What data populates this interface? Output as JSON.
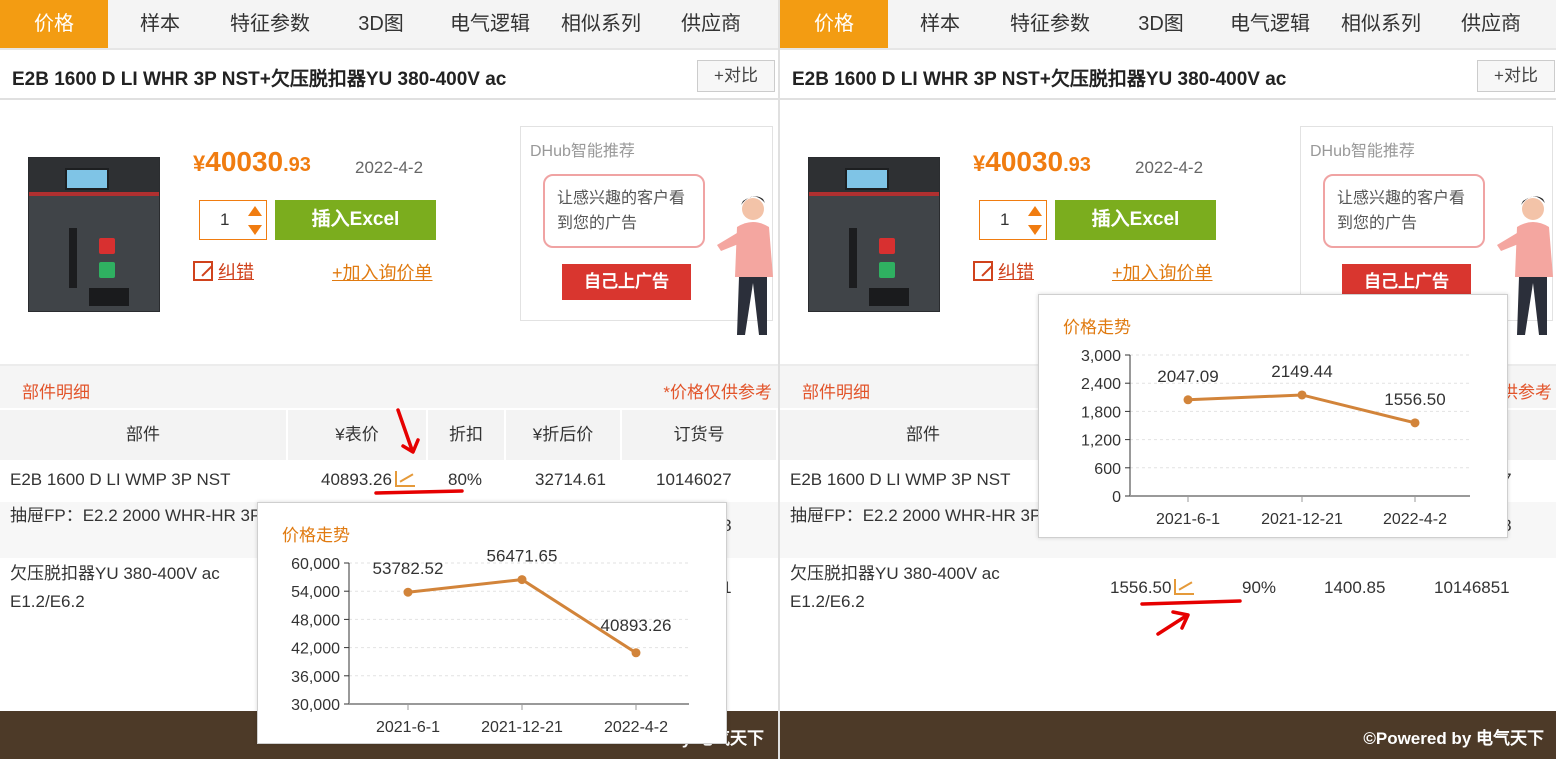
{
  "tabs": [
    "价格",
    "样本",
    "特征参数",
    "3D图",
    "电气逻辑",
    "相似系列",
    "供应商"
  ],
  "product": {
    "title": "E2B 1600 D LI WHR 3P NST+欠压脱扣器YU 380-400V ac",
    "compare": "+对比",
    "price_currency": "¥",
    "price_main": "40030",
    "price_cents": ".93",
    "price_date": "2022-4-2",
    "qty": "1",
    "excel_btn": "插入Excel",
    "fix_link": "纠错",
    "inquiry_link": "+加入询价单"
  },
  "ad": {
    "title": "DHub智能推荐",
    "bubble": "让感兴趣的客户看到您的广告",
    "button": "自己上广告"
  },
  "section": {
    "title": "部件明细",
    "note": "*价格仅供参考"
  },
  "table": {
    "headers": [
      "部件",
      "¥表价",
      "折扣",
      "¥折后价",
      "订货号"
    ],
    "rows": [
      {
        "part": "E2B 1600 D LI WMP 3P NST",
        "list_price": "40893.26",
        "discount": "80%",
        "net_price": "32714.61",
        "order_no": "10146027"
      },
      {
        "part": "抽屉FP：E2.2 2000 WHR-HR 3P",
        "list_price": "",
        "discount": "",
        "net_price": "",
        "order_no": "10145978"
      },
      {
        "part": "欠压脱扣器YU 380-400V ac E1.2/E6.2",
        "list_price": "1556.50",
        "discount": "90%",
        "net_price": "1400.85",
        "order_no": "10146851"
      }
    ]
  },
  "footer": {
    "text": "©Powered by 电气天下"
  },
  "chart_data": [
    {
      "type": "line",
      "title": "价格走势",
      "categories": [
        "2021-6-1",
        "2021-12-21",
        "2022-4-2"
      ],
      "values": [
        53782.52,
        56471.65,
        40893.26
      ],
      "data_labels": [
        "53782.52",
        "56471.65",
        "40893.26"
      ],
      "yticks": [
        "30,000",
        "36,000",
        "42,000",
        "48,000",
        "54,000",
        "60,000"
      ],
      "ylim": [
        30000,
        60000
      ],
      "color": "#d2843a"
    },
    {
      "type": "line",
      "title": "价格走势",
      "categories": [
        "2021-6-1",
        "2021-12-21",
        "2022-4-2"
      ],
      "values": [
        2047.09,
        2149.44,
        1556.5
      ],
      "data_labels": [
        "2047.09",
        "2149.44",
        "1556.50"
      ],
      "yticks": [
        "0",
        "600",
        "1,200",
        "1,800",
        "2,400",
        "3,000"
      ],
      "ylim": [
        0,
        3000
      ],
      "color": "#d2843a"
    }
  ],
  "colors": {
    "accent": "#f39c12",
    "price": "#f07c10",
    "excel": "#7bad1e",
    "ad_button": "#d9362f",
    "footer": "#4d3a28",
    "annotation": "#e60000"
  }
}
